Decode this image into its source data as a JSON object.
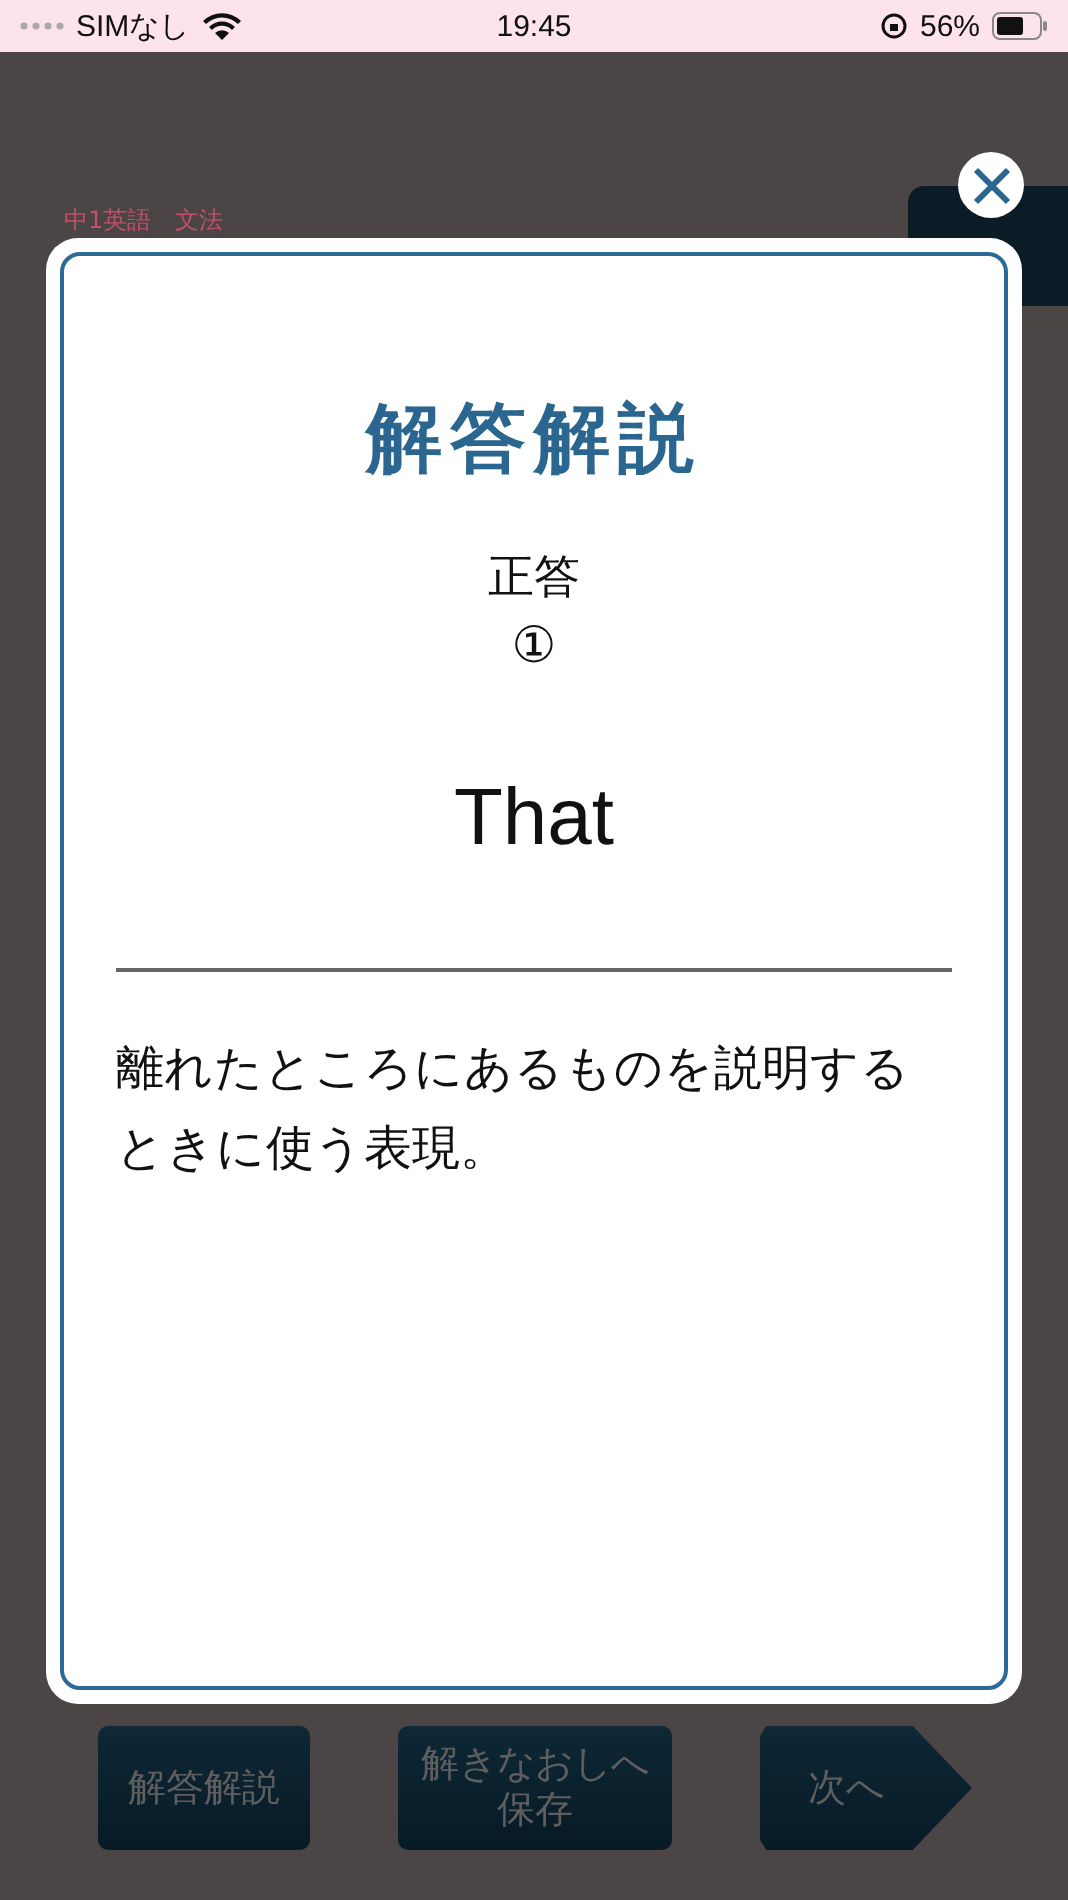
{
  "status_bar": {
    "carrier": "SIMなし",
    "time": "19:45",
    "battery": "56%"
  },
  "page": {
    "subject": "中1英語　文法",
    "buttons": [
      {
        "kind": "plain",
        "label": "解答解説"
      },
      {
        "kind": "plain",
        "lines": [
          "解きなおしへ",
          "保存"
        ]
      },
      {
        "kind": "arrow",
        "label": "次へ"
      }
    ]
  },
  "dialog": {
    "title": "解答解説",
    "answer_label": "正答",
    "answer_number": "①",
    "answer": "That",
    "explanation": "離れたところにあるものを説明するときに使う表現。"
  }
}
